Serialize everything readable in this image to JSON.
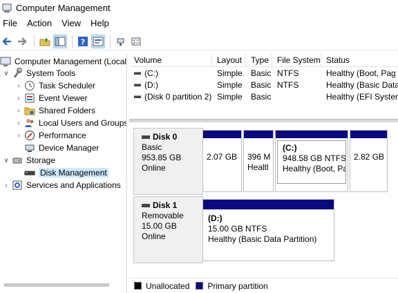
{
  "window": {
    "title": "Computer Management"
  },
  "menu": [
    "File",
    "Action",
    "View",
    "Help"
  ],
  "toolbar": [
    "back-arrow-icon",
    "forward-arrow-icon",
    "up-folder-icon",
    "show-hide-tree-icon",
    "help-icon",
    "properties-icon",
    "connect-icon",
    "checklist-icon"
  ],
  "tree": {
    "root": "Computer Management (Local",
    "system_tools": "System Tools",
    "task_scheduler": "Task Scheduler",
    "event_viewer": "Event Viewer",
    "shared_folders": "Shared Folders",
    "local_users": "Local Users and Groups",
    "performance": "Performance",
    "device_manager": "Device Manager",
    "storage": "Storage",
    "disk_management": "Disk Management",
    "services": "Services and Applications"
  },
  "volume_list": {
    "columns": [
      "Volume",
      "Layout",
      "Type",
      "File System",
      "Status"
    ],
    "rows": [
      [
        "(C:)",
        "Simple",
        "Basic",
        "NTFS",
        "Healthy (Boot, Pag"
      ],
      [
        "(D:)",
        "Simple",
        "Basic",
        "NTFS",
        "Healthy (Basic Data"
      ],
      [
        "(Disk 0 partition 2)",
        "Simple",
        "Basic",
        "",
        "Healthy (EFI Systen"
      ]
    ]
  },
  "disks": [
    {
      "name": "Disk 0",
      "type": "Basic",
      "size": "953.85 GB",
      "status": "Online",
      "partitions": [
        {
          "title": "",
          "size": "2.07 GB",
          "status": ""
        },
        {
          "title": "",
          "size": "396 M",
          "status": "Healtl"
        },
        {
          "title": "(C:)",
          "size": "948.58 GB NTFS",
          "status": "Healthy (Boot, Pa"
        },
        {
          "title": "",
          "size": "2.82 GB",
          "status": ""
        }
      ]
    },
    {
      "name": "Disk 1",
      "type": "Removable",
      "size": "15.00 GB",
      "status": "Online",
      "partitions": [
        {
          "title": "(D:)",
          "size": "15.00 GB NTFS",
          "status": "Healthy (Basic Data Partition)"
        }
      ]
    }
  ],
  "legend": {
    "unallocated": "Unallocated",
    "primary": "Primary partition",
    "unallocated_color": "#000000",
    "primary_color": "#0a0a80"
  }
}
